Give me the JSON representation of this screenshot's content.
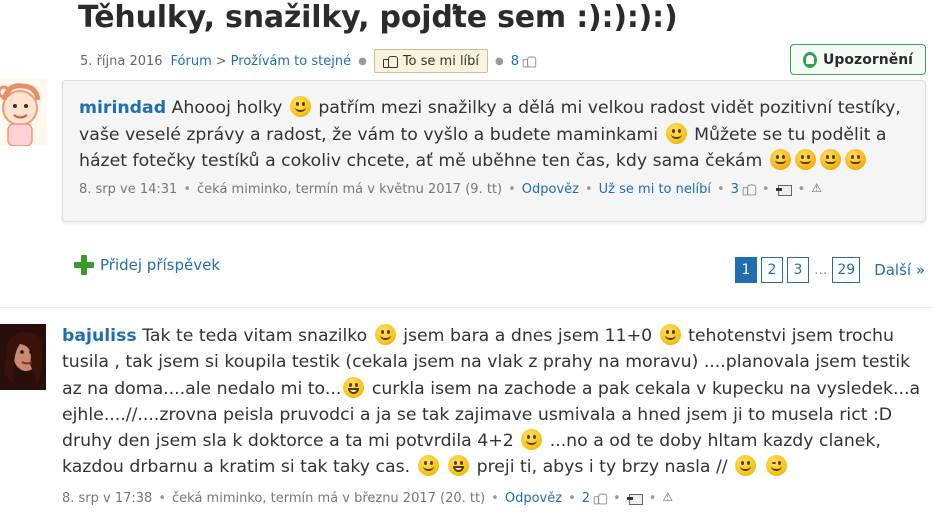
{
  "thread": {
    "title": "Těhulky, snažilky, pojďte sem :):):):)",
    "date": "5. října 2016",
    "breadcrumb_forum": "Fórum",
    "breadcrumb_sep": ">",
    "breadcrumb_section": "Prožívám to stejné",
    "like_label": "To se mi líbí",
    "like_count": "8",
    "notify_label": "Upozornění"
  },
  "first_post": {
    "author": "mirindad",
    "text_1": "Ahoooj holky",
    "text_2": "patřím mezi snažilky a dělá mi velkou radost vidět pozitivní testíky, vaše veselé zprávy a radost, že vám to vyšlo a budete maminkami",
    "text_3": "Můžete se tu podělit a házet fotečky testíků a cokoliv chcete, ať mě uběhne ten čas, kdy sama čekám",
    "time": "8. srp ve 14:31",
    "status": "čeká miminko, termín má v květnu 2017 (9. tt)",
    "reply_label": "Odpověz",
    "unlike_label": "Už se mi to nelíbí",
    "like_count": "3"
  },
  "add_post_label": "Přidej příspěvek",
  "pagination": {
    "pages": [
      "1",
      "2",
      "3"
    ],
    "ellipsis": "...",
    "last": "29",
    "next_label": "Další »"
  },
  "second_post": {
    "author": "bajuliss",
    "text_1": "Tak te teda vitam snazilko",
    "text_2": "jsem bara a dnes jsem 11+0",
    "text_3": "tehotenstvi jsem trochu tusila , tak jsem si koupila testik (cekala jsem na vlak z prahy na moravu) ....planovala jsem testik az na doma....ale nedalo mi to...",
    "text_4": "curkla isem na zachode a pak cekala v kupecku na vysledek...a ejhle....//....zrovna peisla pruvodci a ja se tak zajimave usmivala a hned jsem ji to musela rict :D druhy den jsem sla k doktorce a ta mi potvrdila 4+2",
    "text_5": "...no a od te doby hltam kazdy clanek, kazdou drbarnu a kratim si tak taky cas.",
    "text_6": "preji ti, abys i ty brzy nasla //",
    "time": "8. srp v 17:38",
    "status": "čeká miminko, termín má v březnu 2017 (20. tt)",
    "reply_label": "Odpověz",
    "like_count": "2"
  },
  "colors": {
    "link": "#1f6fb0",
    "notify_border": "#3aa45a",
    "like_bg": "#f7f3dc",
    "add_icon": "#3c9a2a"
  }
}
